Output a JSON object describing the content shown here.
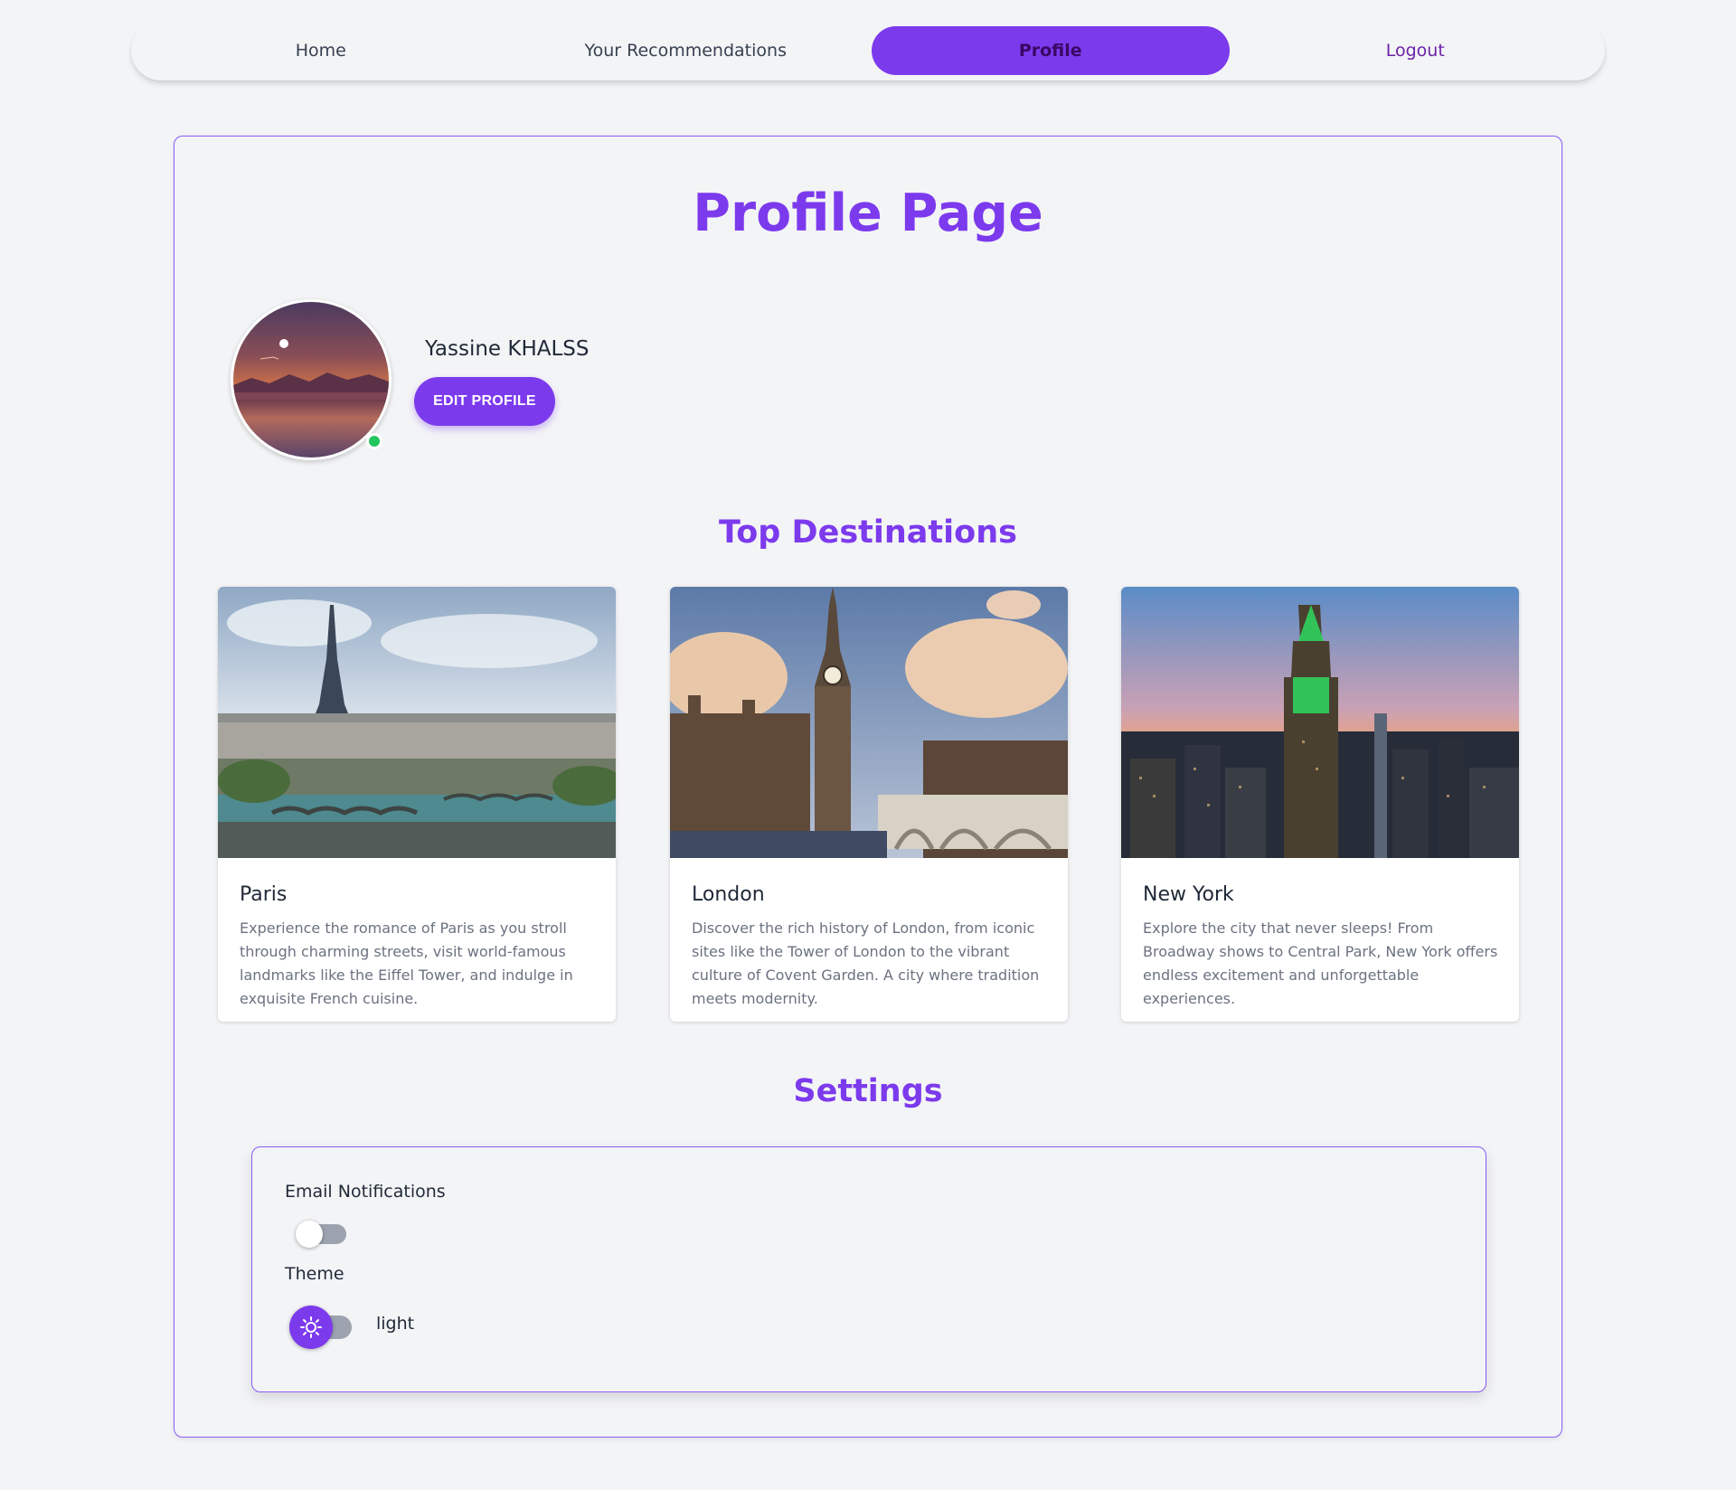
{
  "nav": {
    "items": [
      {
        "label": "Home"
      },
      {
        "label": "Your Recommendations"
      },
      {
        "label": "Profile"
      },
      {
        "label": "Logout"
      }
    ]
  },
  "page": {
    "title": "Profile Page"
  },
  "profile": {
    "name": "Yassine KHALSS",
    "edit_button": "EDIT PROFILE",
    "status": "online"
  },
  "destinations": {
    "title": "Top Destinations",
    "items": [
      {
        "name": "Paris",
        "description": "Experience the romance of Paris as you stroll through charming streets, visit world-famous landmarks like the Eiffel Tower, and indulge in exquisite French cuisine."
      },
      {
        "name": "London",
        "description": "Discover the rich history of London, from iconic sites like the Tower of London to the vibrant culture of Covent Garden. A city where tradition meets modernity."
      },
      {
        "name": "New York",
        "description": "Explore the city that never sleeps! From Broadway shows to Central Park, New York offers endless excitement and unforgettable experiences."
      }
    ]
  },
  "settings": {
    "title": "Settings",
    "email_label": "Email Notifications",
    "email_enabled": false,
    "theme_label": "Theme",
    "theme_value": "light"
  },
  "colors": {
    "accent": "#7c3aed",
    "background": "#f3f4f6",
    "status_online": "#22c55e"
  }
}
